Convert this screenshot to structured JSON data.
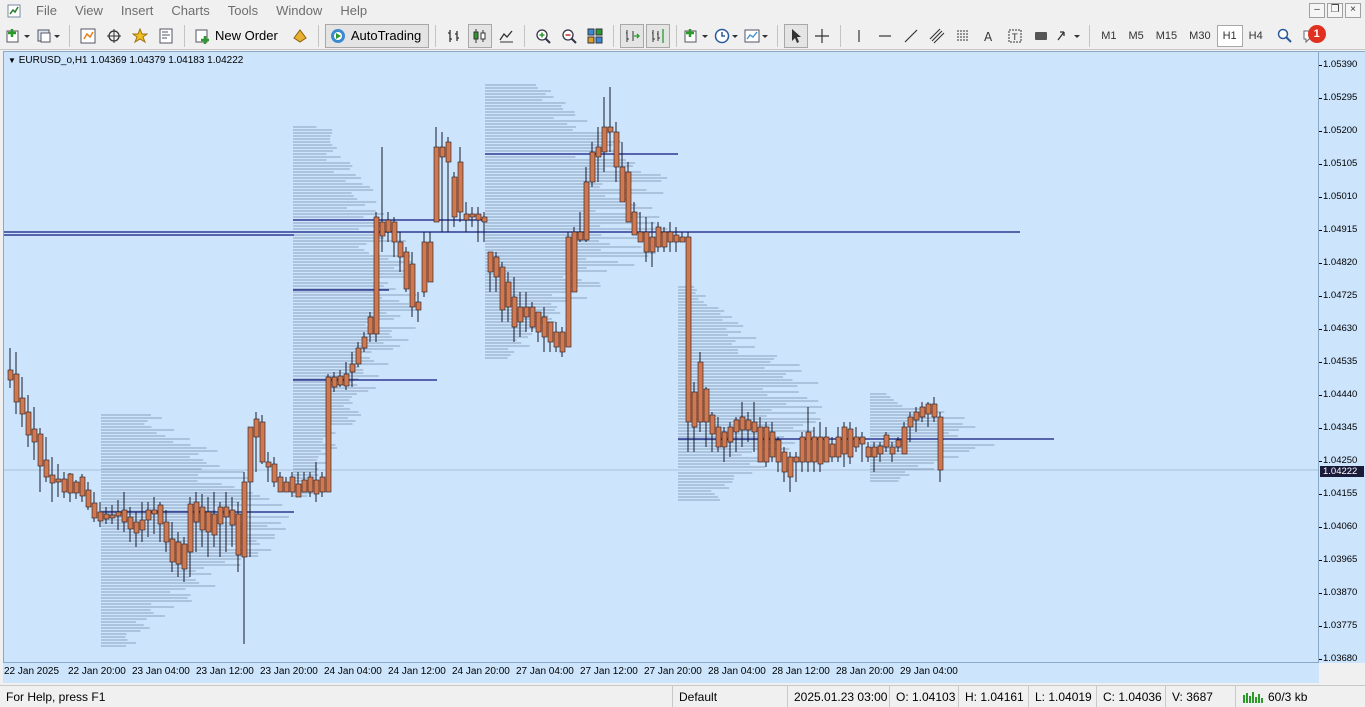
{
  "menu": [
    "File",
    "View",
    "Insert",
    "Charts",
    "Tools",
    "Window",
    "Help"
  ],
  "window_controls": [
    "–",
    "❐",
    "×"
  ],
  "toolbar": {
    "new_order_label": "New Order",
    "autotrading_label": "AutoTrading",
    "timeframes": [
      "M1",
      "M5",
      "M15",
      "M30",
      "H1",
      "H4"
    ],
    "active_timeframe": "H1",
    "notification_count": "1"
  },
  "chart": {
    "symbol_label": "EURUSD_o,H1  1.04369 1.04379 1.04183 1.04222",
    "background_color": "#cce4fc",
    "bull_color": "#3c9ad2",
    "bear_color": "#d2784e",
    "level_line_color": "#101880",
    "current_price": "1.04222",
    "price_labels": [
      "1.05390",
      "1.05295",
      "1.05200",
      "1.05105",
      "1.05010",
      "1.04915",
      "1.04820",
      "1.04725",
      "1.04630",
      "1.04535",
      "1.04440",
      "1.04345",
      "1.04250",
      "1.04155",
      "1.04060",
      "1.03965",
      "1.03870",
      "1.03775",
      "1.03680"
    ],
    "time_labels": [
      "22 Jan 2025",
      "22 Jan 20:00",
      "23 Jan 04:00",
      "23 Jan 12:00",
      "23 Jan 20:00",
      "24 Jan 04:00",
      "24 Jan 12:00",
      "24 Jan 20:00",
      "27 Jan 04:00",
      "27 Jan 12:00",
      "27 Jan 20:00",
      "28 Jan 04:00",
      "28 Jan 12:00",
      "28 Jan 20:00",
      "29 Jan 04:00"
    ]
  },
  "statusbar": {
    "help": "For Help, press F1",
    "profile": "Default",
    "datetime": "2025.01.23 03:00",
    "open": "O: 1.04103",
    "high": "H: 1.04161",
    "low": "L: 1.04019",
    "close": "C: 1.04036",
    "volume": "V: 3687",
    "traffic": "60/3 kb"
  }
}
